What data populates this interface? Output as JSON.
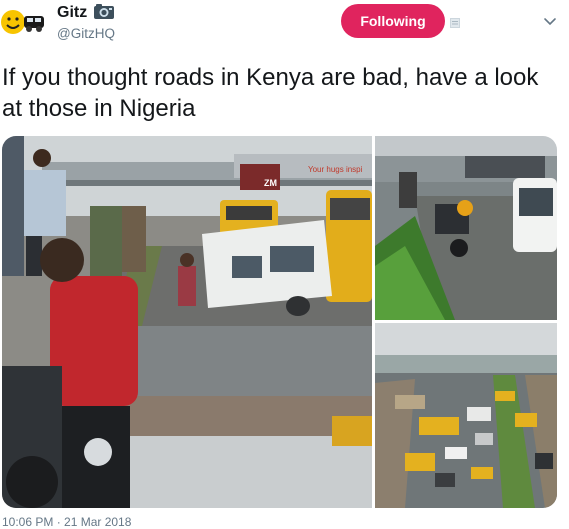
{
  "user": {
    "display_name": "Gitz",
    "handle": "@GitzHQ",
    "avatar_icon": "smiley-car-avatar",
    "badge_icon": "camera-emoji-icon"
  },
  "follow_button": {
    "label": "Following",
    "color": "#e0245e"
  },
  "menu": {
    "icon": "chevron-down-icon"
  },
  "tweet": {
    "text": "If you thought roads in Kenya are bad, have a look at those in Nigeria",
    "timestamp": "10:06 PM · 21 Mar 2018"
  },
  "media": {
    "photos": [
      {
        "id": "main",
        "description_icon": "flooded-road-photo",
        "sign_text": "Your hugs inspi",
        "billboard_text": "ZM"
      },
      {
        "id": "top-right",
        "description_icon": "motorbike-flood-photo"
      },
      {
        "id": "bottom-right",
        "description_icon": "traffic-aerial-photo"
      }
    ]
  }
}
